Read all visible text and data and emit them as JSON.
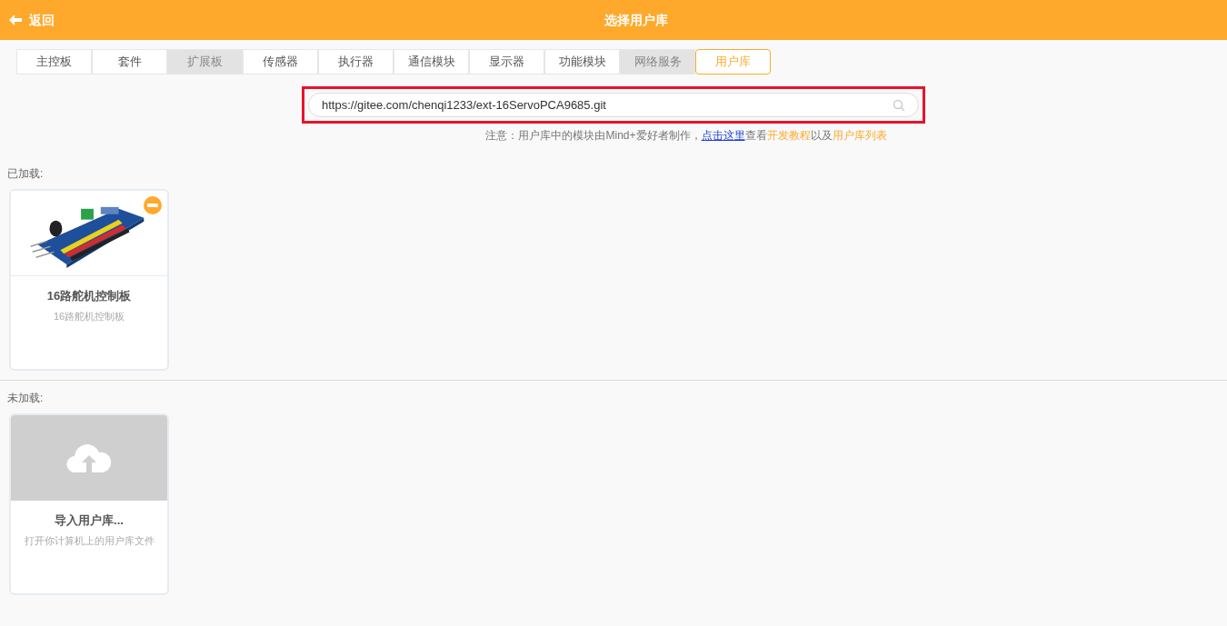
{
  "header": {
    "back": "返回",
    "title": "选择用户库"
  },
  "tabs": [
    {
      "label": "主控板",
      "selected": false,
      "disabled": false
    },
    {
      "label": "套件",
      "selected": false,
      "disabled": false
    },
    {
      "label": "扩展板",
      "selected": false,
      "disabled": true
    },
    {
      "label": "传感器",
      "selected": false,
      "disabled": false
    },
    {
      "label": "执行器",
      "selected": false,
      "disabled": false
    },
    {
      "label": "通信模块",
      "selected": false,
      "disabled": false
    },
    {
      "label": "显示器",
      "selected": false,
      "disabled": false
    },
    {
      "label": "功能模块",
      "selected": false,
      "disabled": false
    },
    {
      "label": "网络服务",
      "selected": false,
      "disabled": true
    },
    {
      "label": "用户库",
      "selected": true,
      "disabled": false
    }
  ],
  "search": {
    "value": "https://gitee.com/chenqi1233/ext-16ServoPCA9685.git",
    "highlighted": true
  },
  "notice": [
    {
      "kind": "text",
      "text": "注意：用户库中的模块由Mind+爱好者制作，"
    },
    {
      "kind": "link",
      "text": "点击这里"
    },
    {
      "kind": "text",
      "text": "查看"
    },
    {
      "kind": "accent",
      "text": "开发教程"
    },
    {
      "kind": "text",
      "text": "以及"
    },
    {
      "kind": "accent",
      "text": "用户库列表"
    }
  ],
  "sections": [
    {
      "title": "已加载:",
      "cards": [
        {
          "kind": "picture",
          "name": "16路舵机控制板",
          "description": "16路舵机控制板",
          "removable": true
        }
      ]
    },
    {
      "title": "未加载:",
      "cards": [
        {
          "kind": "import",
          "name": "导入用户库...",
          "description": "打开你计算机上的用户库文件",
          "removable": false
        }
      ]
    }
  ]
}
